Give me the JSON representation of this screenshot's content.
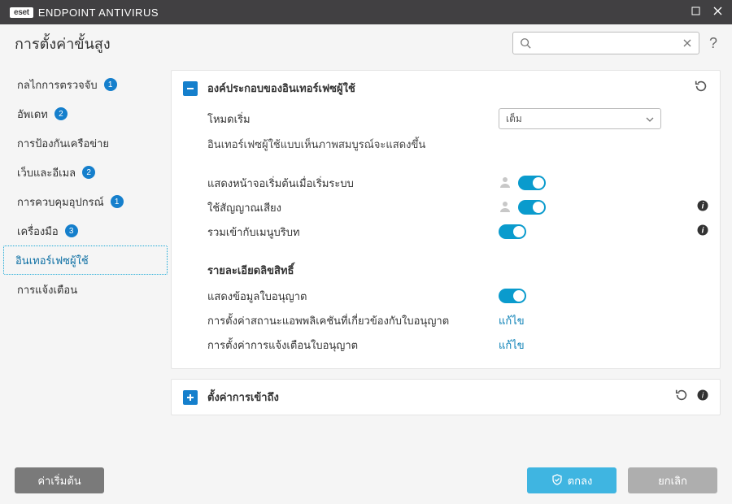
{
  "window": {
    "brand_logo": "eset",
    "product": "ENDPOINT ANTIVIRUS"
  },
  "header": {
    "title": "การตั้งค่าขั้นสูง",
    "search_placeholder": ""
  },
  "sidebar": {
    "items": [
      {
        "label": "กลไกการตรวจจับ",
        "badge": "1"
      },
      {
        "label": "อัพเดท",
        "badge": "2"
      },
      {
        "label": "การป้องกันเครือข่าย",
        "badge": ""
      },
      {
        "label": "เว็บและอีเมล",
        "badge": "2"
      },
      {
        "label": "การควบคุมอุปกรณ์",
        "badge": "1"
      },
      {
        "label": "เครื่องมือ",
        "badge": "3"
      },
      {
        "label": "อินเทอร์เฟซผู้ใช้",
        "badge": ""
      },
      {
        "label": "การแจ้งเตือน",
        "badge": ""
      }
    ],
    "active_index": 6
  },
  "panel_ui": {
    "title": "องค์ประกอบของอินเทอร์เฟซผู้ใช้",
    "start_mode_label": "โหมดเริ่ม",
    "start_mode_value": "เต็ม",
    "start_mode_note": "อินเทอร์เฟซผู้ใช้แบบเห็นภาพสมบูรณ์จะแสดงขึ้น",
    "row_splash_label": "แสดงหน้าจอเริ่มต้นเมื่อเริ่มระบบ",
    "row_sound_label": "ใช้สัญญาณเสียง",
    "row_context_label": "รวมเข้ากับเมนูบริบท",
    "license_heading": "รายละเอียดลิขสิทธิ์",
    "row_show_license_label": "แสดงข้อมูลใบอนุญาต",
    "row_app_status_label": "การตั้งค่าสถานะแอพพลิเคชันที่เกี่ยวข้องกับใบอนุญาต",
    "row_license_notif_label": "การตั้งค่าการแจ้งเตือนใบอนุญาต",
    "edit_link": "แก้ไข"
  },
  "panel_access": {
    "title": "ตั้งค่าการเข้าถึง"
  },
  "footer": {
    "default": "ค่าเริ่มต้น",
    "ok": "ตกลง",
    "cancel": "ยกเลิก"
  }
}
